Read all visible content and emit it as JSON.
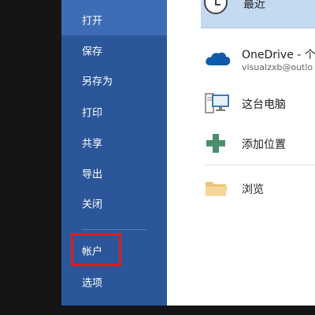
{
  "sidebar": {
    "items": [
      {
        "label": "打开",
        "active": true
      },
      {
        "label": "保存"
      },
      {
        "label": "另存为"
      },
      {
        "label": "打印"
      },
      {
        "label": "共享"
      },
      {
        "label": "导出"
      },
      {
        "label": "关闭"
      },
      {
        "label": "帐户",
        "highlighted": true
      },
      {
        "label": "选项"
      }
    ]
  },
  "main": {
    "recent_label": "最近",
    "locations": [
      {
        "title": "OneDrive - 个",
        "subtitle": "visualzxb@outlo",
        "icon": "cloud-icon"
      },
      {
        "title": "这台电脑",
        "icon": "computer-icon"
      },
      {
        "title": "添加位置",
        "icon": "plus-icon"
      },
      {
        "title": "浏览",
        "icon": "folder-icon"
      }
    ]
  },
  "colors": {
    "sidebar_bg": "#2b579a",
    "sidebar_active": "#3e6db5",
    "highlight_border": "#e01b1b",
    "recent_bg": "#c5d9f1",
    "onedrive_blue": "#0f5ba9",
    "plus_green": "#4a8f6d",
    "folder_tan": "#e9c57b"
  }
}
